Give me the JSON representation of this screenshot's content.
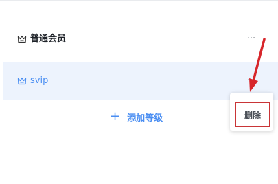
{
  "levels": [
    {
      "label": "普通会员",
      "icon": "crown-icon",
      "icon_color": "#333333",
      "more_label": "···"
    },
    {
      "label": "svip",
      "icon": "crown-icon",
      "icon_color": "#4a8ef2",
      "more_label": "···"
    }
  ],
  "add_level": {
    "plus": "+",
    "label": "添加等级"
  },
  "menu": {
    "delete_label": "删除"
  },
  "colors": {
    "accent": "#4a8ef2",
    "selected_row_bg": "#edf3fd",
    "annotation_red": "#d7262b"
  }
}
